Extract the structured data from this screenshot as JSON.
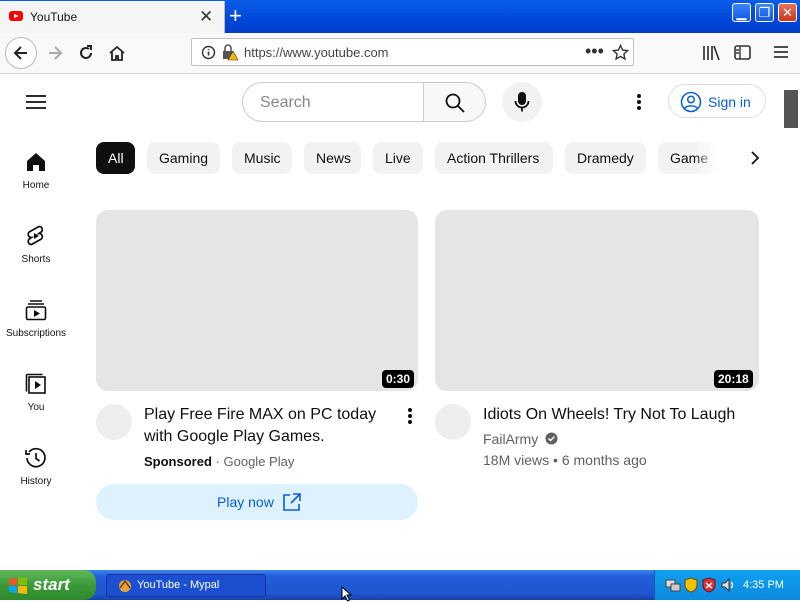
{
  "browser": {
    "tab_title": "YouTube",
    "url": "https://www.youtube.com"
  },
  "youtube": {
    "search_placeholder": "Search",
    "sign_in": "Sign in",
    "sidebar": [
      {
        "label": "Home",
        "icon": "home-icon"
      },
      {
        "label": "Shorts",
        "icon": "shorts-icon"
      },
      {
        "label": "Subscriptions",
        "icon": "subscriptions-icon"
      },
      {
        "label": "You",
        "icon": "you-icon"
      },
      {
        "label": "History",
        "icon": "history-icon"
      }
    ],
    "chips": [
      "All",
      "Gaming",
      "Music",
      "News",
      "Live",
      "Action Thrillers",
      "Dramedy",
      "Game"
    ],
    "videos": [
      {
        "duration": "0:30",
        "title_line1": "Play Free Fire MAX on PC today",
        "title_line2": "with Google Play Games.",
        "sponsored": "Sponsored",
        "separator": "·",
        "advertiser": "Google Play",
        "cta": "Play now"
      },
      {
        "duration": "20:18",
        "title": "Idiots On Wheels! Try Not To Laugh",
        "channel": "FailArmy",
        "views": "18M views",
        "separator": "•",
        "age": "6 months ago"
      }
    ]
  },
  "taskbar": {
    "start": "start",
    "task_item": "YouTube - Mypal",
    "clock": "4:35 PM"
  },
  "colors": {
    "accent": "#065fd4",
    "chip_active": "#0f0f0f",
    "taskbar": "#245edb",
    "start": "#3c9a3a"
  }
}
